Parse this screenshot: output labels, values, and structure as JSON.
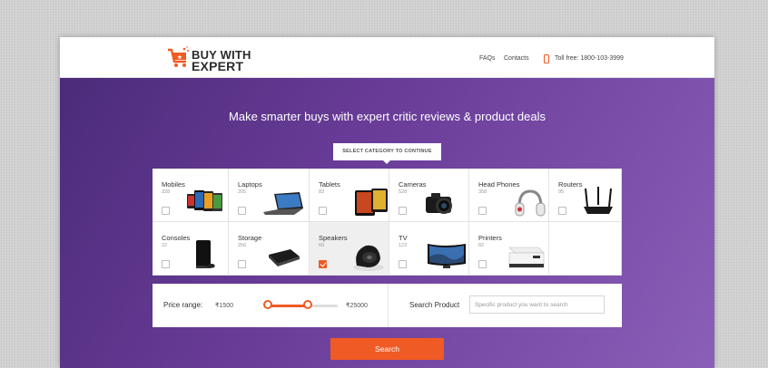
{
  "brand": {
    "line1": "BUY WITH",
    "line2": "EXPERT",
    "accent": "#f05a24"
  },
  "nav": {
    "faq": "FAQs",
    "contacts": "Contacts",
    "toll_free": "Toll free: 1800-103-3999"
  },
  "hero": {
    "title": "Make smarter buys with expert critic reviews & product deals"
  },
  "category_prompt": "SELECT CATEGORY TO CONTINUE",
  "categories": [
    {
      "name": "Mobiles",
      "count": "328",
      "selected": false,
      "icon": "mobiles-icon"
    },
    {
      "name": "Laptops",
      "count": "205",
      "selected": false,
      "icon": "laptop-icon"
    },
    {
      "name": "Tablets",
      "count": "83",
      "selected": false,
      "icon": "tablet-icon"
    },
    {
      "name": "Cameras",
      "count": "528",
      "selected": false,
      "icon": "camera-icon"
    },
    {
      "name": "Head Phones",
      "count": "358",
      "selected": false,
      "icon": "headphones-icon"
    },
    {
      "name": "Routers",
      "count": "95",
      "selected": false,
      "icon": "router-icon"
    },
    {
      "name": "Consoles",
      "count": "22",
      "selected": false,
      "icon": "console-icon"
    },
    {
      "name": "Storage",
      "count": "256",
      "selected": false,
      "icon": "hard-drive-icon"
    },
    {
      "name": "Speakers",
      "count": "69",
      "selected": true,
      "icon": "speaker-icon"
    },
    {
      "name": "TV",
      "count": "123",
      "selected": false,
      "icon": "tv-icon"
    },
    {
      "name": "Printers",
      "count": "82",
      "selected": false,
      "icon": "printer-icon"
    }
  ],
  "price": {
    "label": "Price range:",
    "min": "₹1500",
    "max": "₹25000"
  },
  "search": {
    "label": "Search Product",
    "placeholder": "Specific product you want to search",
    "button": "Search"
  }
}
